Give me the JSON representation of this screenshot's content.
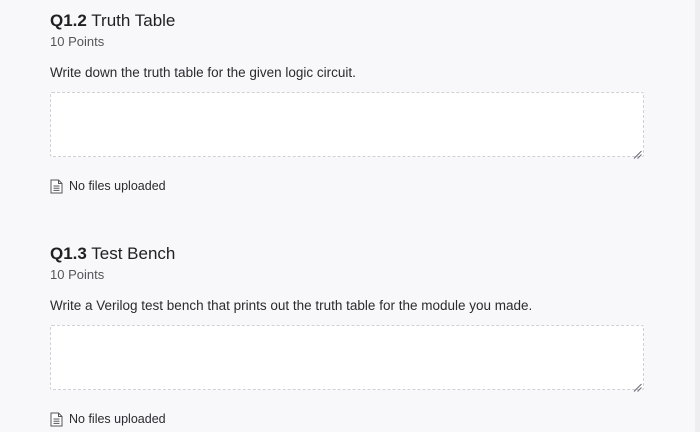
{
  "questions": [
    {
      "number": "Q1.2",
      "title": "Truth Table",
      "points": "10 Points",
      "prompt": "Write down the truth table for the given logic circuit.",
      "answer_value": "",
      "files_status": "No files uploaded",
      "files_icon": "file-text-icon"
    },
    {
      "number": "Q1.3",
      "title": "Test Bench",
      "points": "10 Points",
      "prompt": "Write a Verilog test bench that prints out the truth table for the module you made.",
      "answer_value": "",
      "files_status": "No files uploaded",
      "files_icon": "file-text-icon"
    }
  ]
}
